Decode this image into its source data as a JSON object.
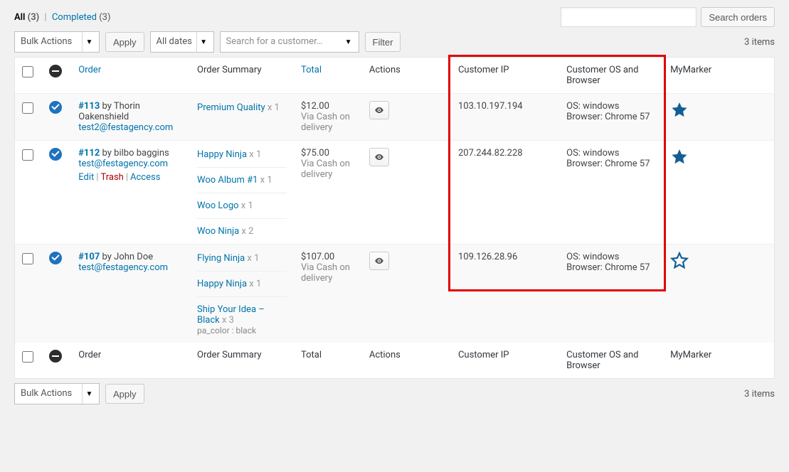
{
  "filters": {
    "all_label": "All",
    "all_count": "(3)",
    "completed_label": "Completed",
    "completed_count": "(3)"
  },
  "search": {
    "button": "Search orders"
  },
  "bulk": {
    "placeholder": "Bulk Actions",
    "apply": "Apply"
  },
  "dates_filter": "All dates",
  "customer_search": "Search for a customer…",
  "filter_btn": "Filter",
  "items_count": "3 items",
  "columns": {
    "order": "Order",
    "summary": "Order Summary",
    "total": "Total",
    "actions": "Actions",
    "ip": "Customer IP",
    "os": "Customer OS and Browser",
    "marker": "MyMarker"
  },
  "rows": [
    {
      "order_id": "#113",
      "by": " by Thorin Oakenshield",
      "email": "test2@festagency.com",
      "show_actions": false,
      "items": [
        {
          "name": "Premium Quality",
          "qty": " x 1",
          "meta": ""
        }
      ],
      "total": "$12.00",
      "via": "Via Cash on delivery",
      "ip": "103.10.197.194",
      "os": "OS: windows",
      "browser": "Browser: Chrome 57",
      "marked": true
    },
    {
      "order_id": "#112",
      "by": " by bilbo baggins",
      "email": "test@festagency.com",
      "show_actions": true,
      "items": [
        {
          "name": "Happy Ninja",
          "qty": " x 1",
          "meta": ""
        },
        {
          "name": "Woo Album #1",
          "qty": " x 1",
          "meta": ""
        },
        {
          "name": "Woo Logo",
          "qty": " x 1",
          "meta": ""
        },
        {
          "name": "Woo Ninja",
          "qty": " x 2",
          "meta": ""
        }
      ],
      "total": "$75.00",
      "via": "Via Cash on delivery",
      "ip": "207.244.82.228",
      "os": "OS: windows",
      "browser": "Browser: Chrome 57",
      "marked": true
    },
    {
      "order_id": "#107",
      "by": " by John Doe",
      "email": "test@festagency.com",
      "show_actions": false,
      "items": [
        {
          "name": "Flying Ninja",
          "qty": " x 1",
          "meta": ""
        },
        {
          "name": "Happy Ninja",
          "qty": " x 1",
          "meta": ""
        },
        {
          "name": "Ship Your Idea – Black",
          "qty": " x 3",
          "meta": "pa_color : black"
        }
      ],
      "total": "$107.00",
      "via": "Via Cash on delivery",
      "ip": "109.126.28.96",
      "os": "OS: windows",
      "browser": "Browser: Chrome 57",
      "marked": false
    }
  ],
  "row_actions": {
    "edit": "Edit",
    "trash": "Trash",
    "access": "Access"
  }
}
